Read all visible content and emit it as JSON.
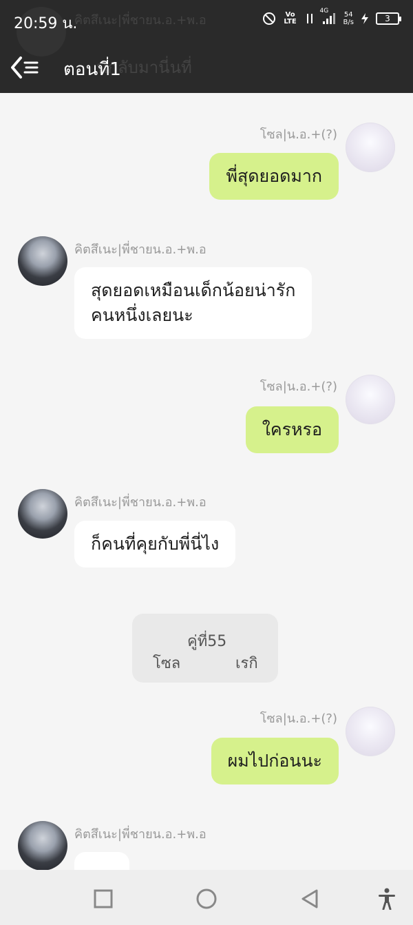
{
  "status": {
    "time": "20:59 น.",
    "volte": "Vo LTE",
    "network": "4G",
    "speed_value": "54",
    "speed_unit": "B/s",
    "battery": "3"
  },
  "header": {
    "title": "ตอนที่1",
    "ghost_name": "คิตสึเนะ|พี่ชายน.อ.+พ.อ",
    "ghost_text": "นกลับมานี่นที่"
  },
  "messages": [
    {
      "side": "right",
      "name": "โซล|น.อ.+(?)",
      "text": "พี่สุดยอดมาก"
    },
    {
      "side": "left",
      "name": "คิตสึเนะ|พี่ชายน.อ.+พ.อ",
      "text_line1": "สุดยอดเหมือนเด็กน้อยน่ารัก",
      "text_line2": "คนหนึ่งเลยนะ"
    },
    {
      "side": "right",
      "name": "โซล|น.อ.+(?)",
      "text": "ใครหรอ"
    },
    {
      "side": "left",
      "name": "คิตสึเนะ|พี่ชายน.อ.+พ.อ",
      "text": "ก็คนที่คุยกับพี่นี่ไง"
    },
    {
      "side": "right",
      "name": "โซล|น.อ.+(?)",
      "text": "ผมไปก่อนนะ"
    },
    {
      "side": "left",
      "name": "คิตสึเนะ|พี่ชายน.อ.+พ.อ",
      "text": ""
    }
  ],
  "card": {
    "line1": "คู่ที่55",
    "left": "โซล",
    "right": "เรกิ"
  },
  "navbar": {
    "icons": [
      "square-icon",
      "circle-icon",
      "triangle-back-icon",
      "accessibility-icon"
    ]
  }
}
